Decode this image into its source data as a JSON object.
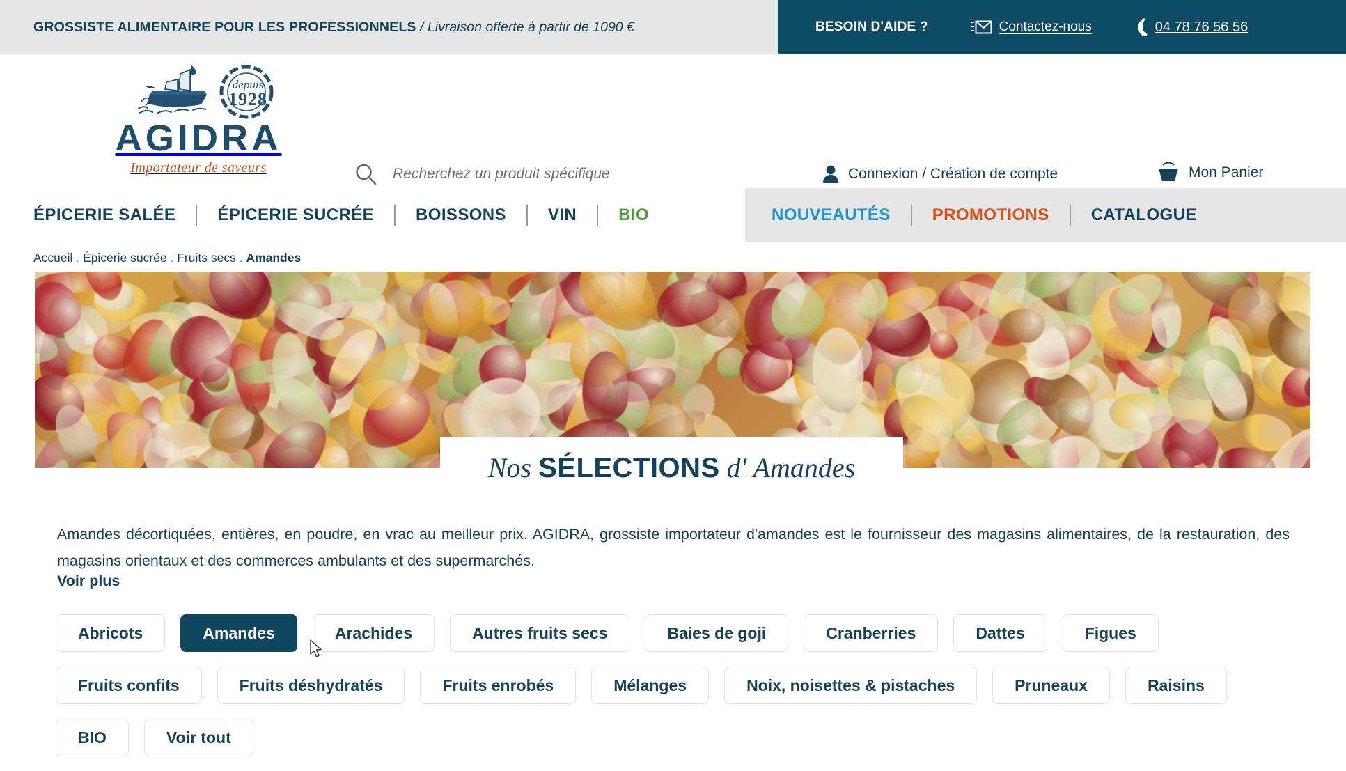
{
  "topbar": {
    "tagline_strong": "GROSSISTE ALIMENTAIRE POUR LES PROFESSIONNELS",
    "tagline_italic": " / Livraison offerte à partir de 1090 €",
    "help_label": "BESOIN D'AIDE ?",
    "contact_label": "Contactez-nous",
    "contact_icon": "envelope-icon",
    "phone_number": "04 78 76 56 56",
    "phone_icon": "phone-icon",
    "bg_color": "#0d4a63",
    "left_bg_color": "#e6e6e6"
  },
  "header": {
    "logo_word": "AGIDRA",
    "logo_tagline": "Importateur de saveurs",
    "logo_badge_line1": "depuis",
    "logo_badge_line2": "1928",
    "logo_icon": "ship-icon",
    "search_placeholder": "Recherchez un produit spécifique",
    "search_value": "",
    "search_icon": "search-icon",
    "account_label": "Connexion / Création de compte",
    "account_icon": "user-icon",
    "cart_label": "Mon Panier",
    "cart_icon": "basket-icon"
  },
  "nav": {
    "left_items": [
      {
        "label": "ÉPICERIE SALÉE",
        "style": "default"
      },
      {
        "label": "ÉPICERIE SUCRÉE",
        "style": "default"
      },
      {
        "label": "BOISSONS",
        "style": "default"
      },
      {
        "label": "VIN",
        "style": "default"
      },
      {
        "label": "BIO",
        "style": "bio"
      }
    ],
    "right_items": [
      {
        "label": "NOUVEAUTÉS",
        "style": "nouveautes"
      },
      {
        "label": "PROMOTIONS",
        "style": "promotions"
      },
      {
        "label": "CATALOGUE",
        "style": "default"
      }
    ],
    "colors": {
      "default": "#14425c",
      "bio": "#4e9b3f",
      "nouveautes": "#1f93d1",
      "promotions": "#d9521c"
    }
  },
  "breadcrumb": {
    "items": [
      "Accueil",
      "Épicerie sucrée",
      "Fruits secs",
      "Amandes"
    ],
    "separator": " . ",
    "current": "Amandes"
  },
  "hero": {
    "title_prefix": "Nos ",
    "title_main": "SÉLECTIONS",
    "title_suffix": " d' Amandes",
    "image_alt": "mélange de fruits secs, amandes, raisins et cranberries"
  },
  "main": {
    "description": "Amandes décortiquées, entières, en poudre, en vrac au meilleur prix. AGIDRA, grossiste importateur d'amandes est le fournisseur des magasins alimentaires, de la restauration, des magasins orientaux et des commerces ambulants et des supermarchés.",
    "voir_plus": "Voir plus",
    "filters": [
      {
        "label": "Abricots",
        "active": false
      },
      {
        "label": "Amandes",
        "active": true
      },
      {
        "label": "Arachides",
        "active": false
      },
      {
        "label": "Autres fruits secs",
        "active": false
      },
      {
        "label": "Baies de goji",
        "active": false
      },
      {
        "label": "Cranberries",
        "active": false
      },
      {
        "label": "Dattes",
        "active": false
      },
      {
        "label": "Figues",
        "active": false
      },
      {
        "label": "Fruits confits",
        "active": false
      },
      {
        "label": "Fruits déshydratés",
        "active": false
      },
      {
        "label": "Fruits enrobés",
        "active": false
      },
      {
        "label": "Mélanges",
        "active": false
      },
      {
        "label": "Noix, noisettes & pistaches",
        "active": false
      },
      {
        "label": "Pruneaux",
        "active": false
      },
      {
        "label": "Raisins",
        "active": false
      },
      {
        "label": "BIO",
        "active": false
      },
      {
        "label": "Voir tout",
        "active": false
      }
    ]
  }
}
